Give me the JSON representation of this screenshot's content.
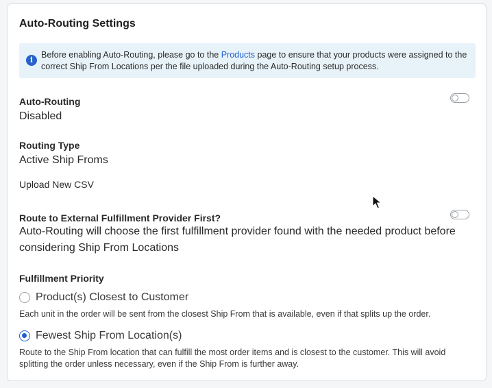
{
  "title": "Auto-Routing Settings",
  "info": {
    "text_before": "Before enabling Auto-Routing, please go to the ",
    "link": "Products",
    "text_after": " page to ensure that your products were assigned to the correct Ship From Locations per the file uploaded during the Auto-Routing setup process."
  },
  "auto_routing": {
    "label": "Auto-Routing",
    "value": "Disabled",
    "toggle_on": false
  },
  "routing_type": {
    "label": "Routing Type",
    "value": "Active Ship Froms"
  },
  "upload_link": "Upload New CSV",
  "external_provider": {
    "label": "Route to External Fulfillment Provider First?",
    "description": "Auto-Routing will choose the first fulfillment provider found with the needed product before considering Ship From Locations",
    "toggle_on": false
  },
  "fulfillment_priority": {
    "label": "Fulfillment Priority",
    "options": [
      {
        "label": "Product(s) Closest to Customer",
        "description": "Each unit in the order will be sent from the closest Ship From that is available, even if that splits up the order.",
        "selected": false
      },
      {
        "label": "Fewest Ship From Location(s)",
        "description": "Route to the Ship From location that can fulfill the most order items and is closest to the customer. This will avoid splitting the order unless necessary, even if the Ship From is further away.",
        "selected": true
      }
    ]
  },
  "colors": {
    "accent": "#1f5fcf",
    "info_background": "#e8f3f9"
  },
  "icons": {
    "info": "info-circle-icon",
    "cursor": "mouse-pointer-icon"
  }
}
